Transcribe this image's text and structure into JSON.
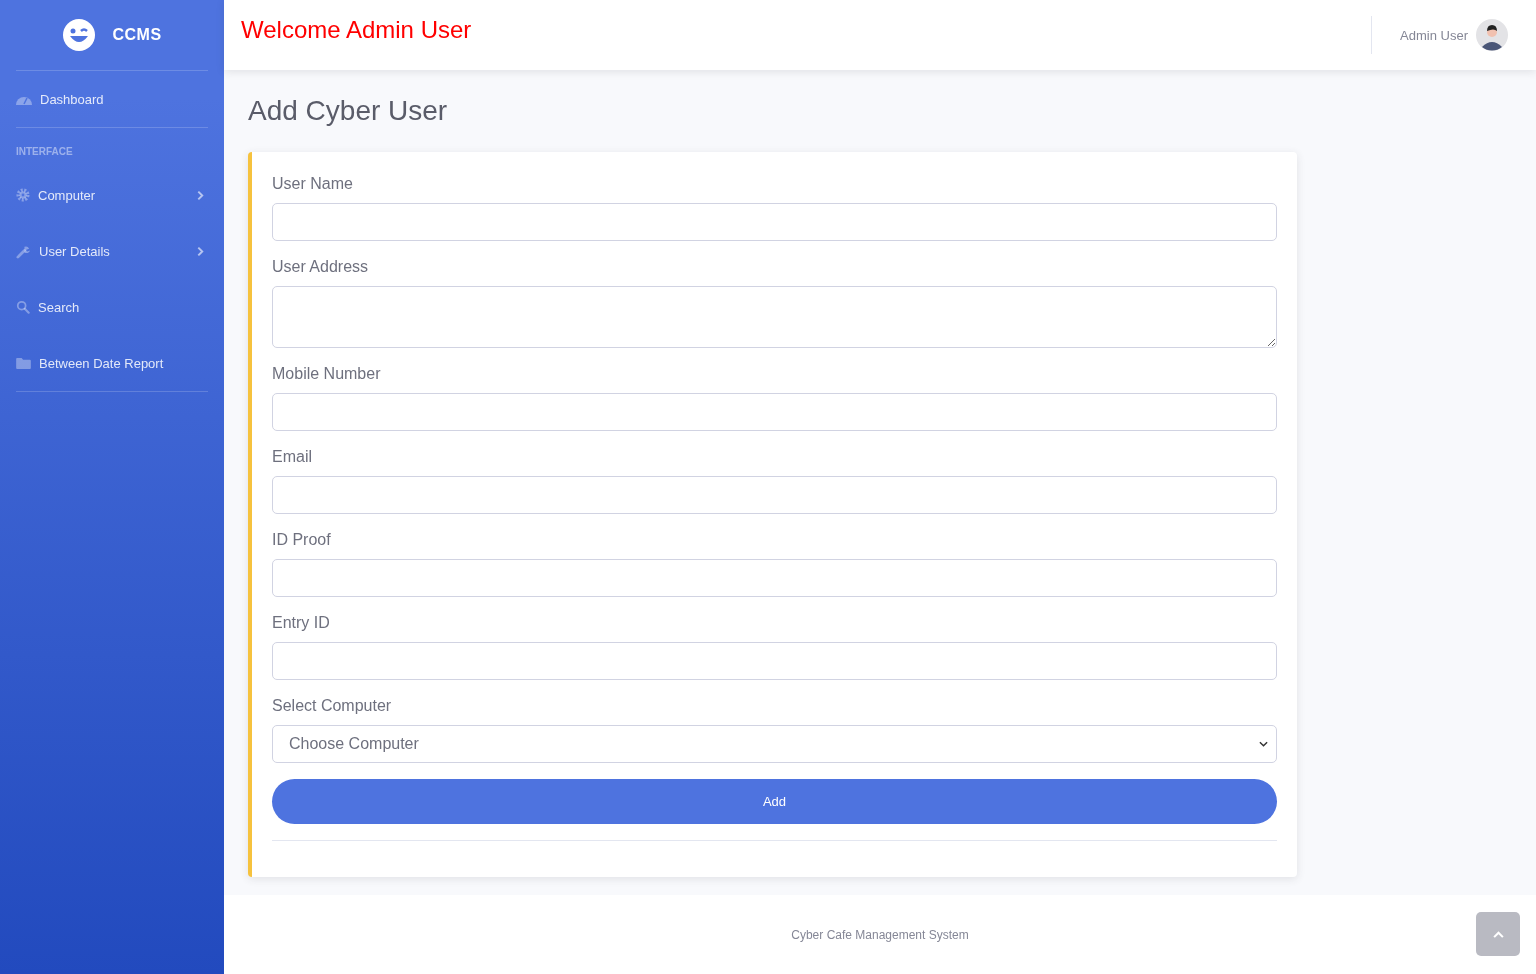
{
  "sidebar": {
    "brand": "CCMS",
    "items": [
      {
        "kind": "link",
        "label": "Dashboard",
        "submenu": false
      },
      {
        "kind": "divider"
      },
      {
        "kind": "heading",
        "label": "INTERFACE"
      },
      {
        "kind": "link",
        "label": "Computer",
        "submenu": true
      },
      {
        "kind": "link",
        "label": "User Details",
        "submenu": true
      },
      {
        "kind": "link",
        "label": "Search",
        "submenu": false
      },
      {
        "kind": "link",
        "label": "Between Date Report",
        "submenu": false
      },
      {
        "kind": "divider"
      }
    ]
  },
  "topbar": {
    "welcome": "Welcome  Admin User",
    "user_name": "Admin User"
  },
  "page": {
    "title": "Add Cyber User"
  },
  "form": {
    "fields": [
      {
        "kind": "input",
        "label": "User Name"
      },
      {
        "kind": "textarea",
        "label": "User Address"
      },
      {
        "kind": "input",
        "label": "Mobile Number"
      },
      {
        "kind": "input",
        "label": "Email"
      },
      {
        "kind": "input",
        "label": "ID Proof"
      },
      {
        "kind": "input",
        "label": "Entry ID"
      },
      {
        "kind": "select",
        "label": "Select Computer",
        "value": "Choose Computer"
      }
    ],
    "submit": "Add"
  },
  "footer": {
    "text": "Cyber Cafe Management System"
  }
}
